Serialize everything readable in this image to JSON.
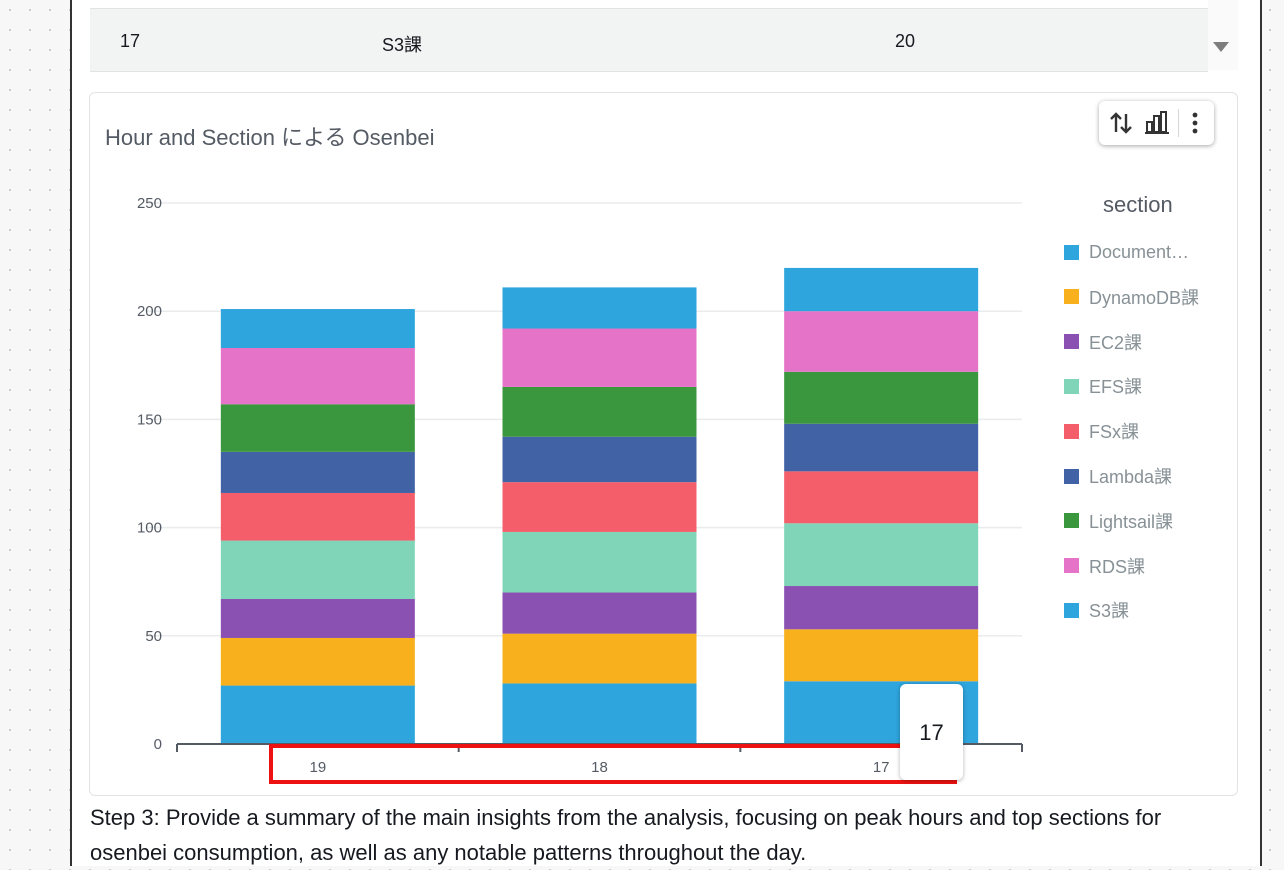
{
  "table": {
    "row": {
      "hour": "17",
      "section": "S3課",
      "value": "20"
    }
  },
  "chart_panel": {
    "title": "Hour and Section による Osenbei",
    "toolbar": {
      "sort_icon": "sort-arrows-icon",
      "chart_type_icon": "bar-chart-icon",
      "more_icon": "more-vertical-icon"
    },
    "tooltip_value": "17"
  },
  "chart_data": {
    "type": "bar",
    "stacked": true,
    "title": "Hour and Section による Osenbei",
    "xlabel": "",
    "ylabel": "",
    "categories": [
      "19",
      "18",
      "17"
    ],
    "ylim": [
      0,
      250
    ],
    "yticks": [
      "0",
      "50",
      "100",
      "150",
      "200",
      "250"
    ],
    "grid": true,
    "legend_title": "section",
    "legend_position": "right",
    "series": [
      {
        "name": "Document…",
        "color": "#2ea5dd",
        "values": [
          27,
          28,
          29
        ]
      },
      {
        "name": "DynamoDB課",
        "color": "#f8b01c",
        "values": [
          22,
          23,
          24
        ]
      },
      {
        "name": "EC2課",
        "color": "#8a50b2",
        "values": [
          18,
          19,
          20
        ]
      },
      {
        "name": "EFS課",
        "color": "#80d5b8",
        "values": [
          27,
          28,
          29
        ]
      },
      {
        "name": "FSx課",
        "color": "#f45e6b",
        "values": [
          22,
          23,
          24
        ]
      },
      {
        "name": "Lambda課",
        "color": "#4163a6",
        "values": [
          19,
          21,
          22
        ]
      },
      {
        "name": "Lightsail課",
        "color": "#3b973e",
        "values": [
          22,
          23,
          24
        ]
      },
      {
        "name": "RDS課",
        "color": "#e574c8",
        "values": [
          26,
          27,
          28
        ]
      },
      {
        "name": "S3課",
        "color": "#2ea5dd",
        "values": [
          18,
          19,
          20
        ]
      }
    ]
  },
  "step_text": "Step 3: Provide a summary of the main insights from the analysis, focusing on peak hours and top sections for osenbei consumption, as well as any notable patterns throughout the day."
}
